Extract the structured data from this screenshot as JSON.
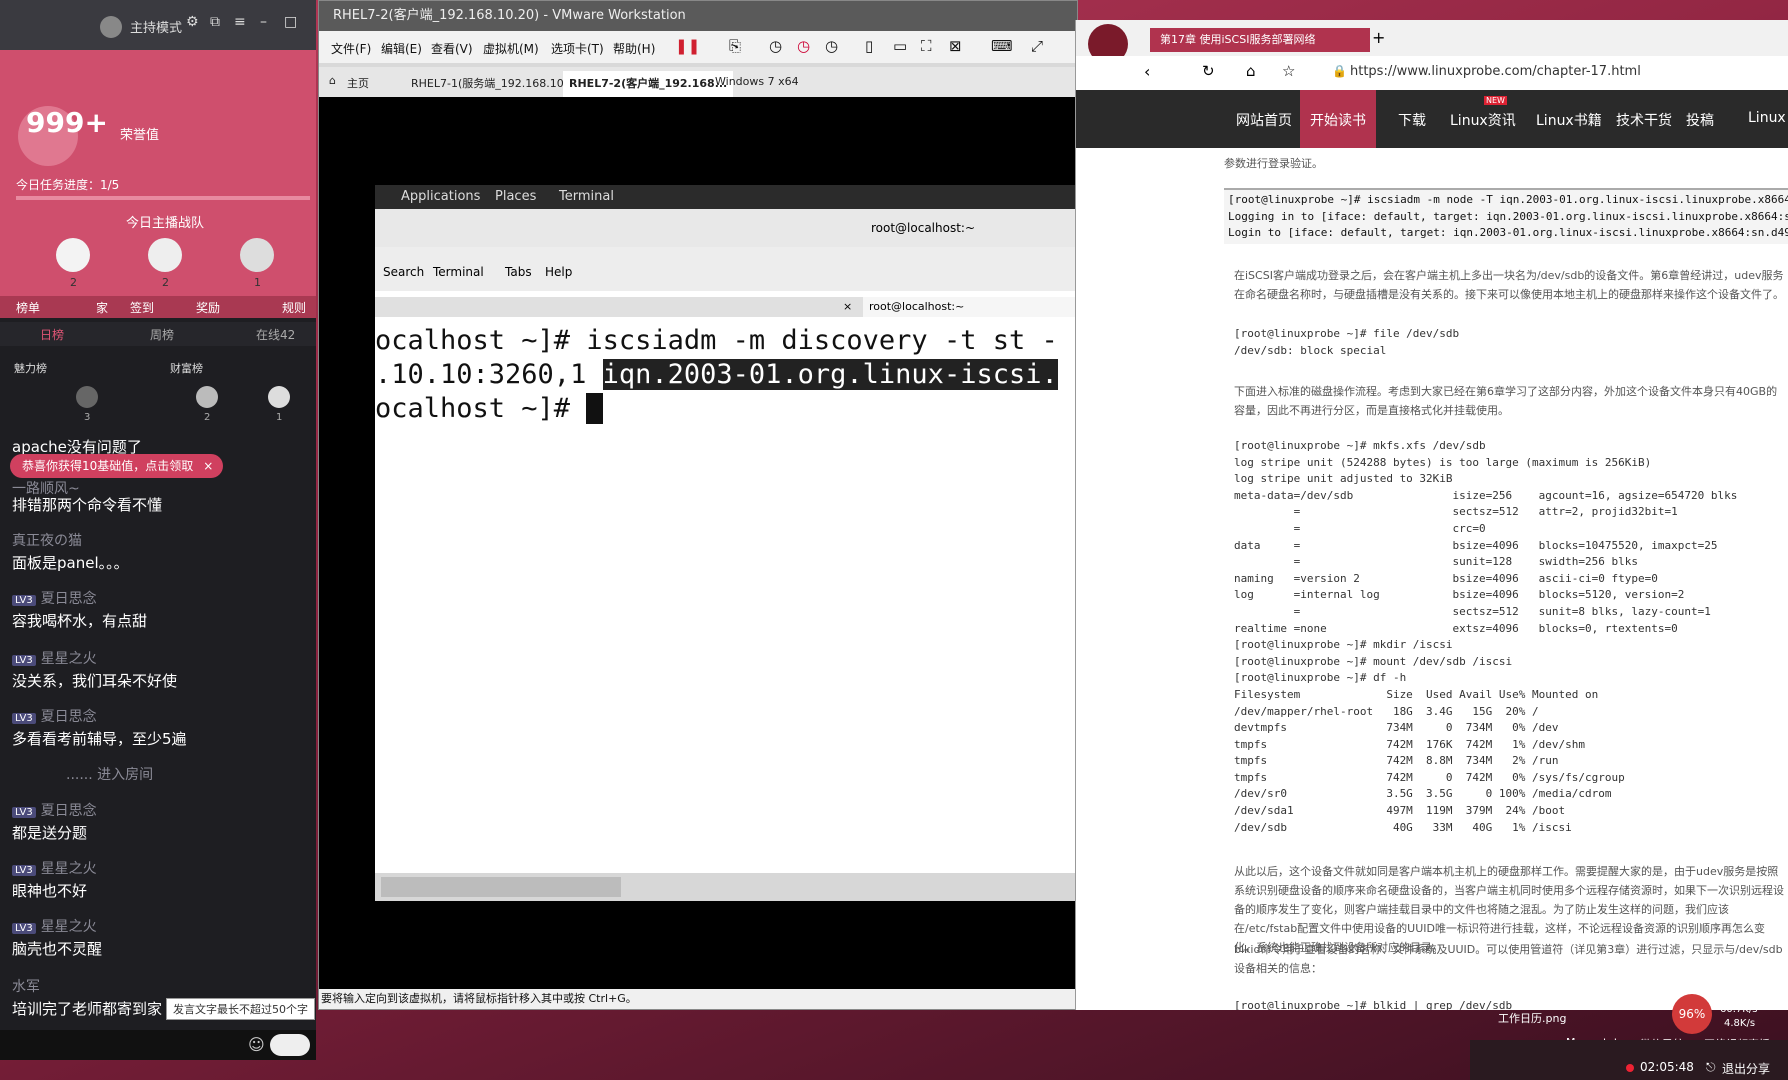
{
  "live_panel": {
    "mode_label": "主持模式",
    "score": "999+",
    "honor_label": "荣誉值",
    "task_progress": "今日任务进度：1/5",
    "anchor_team": "今日主播战队",
    "avatars_counts": [
      "2",
      "2",
      "1"
    ],
    "bottom_tabs": [
      "榜单",
      "家",
      "签到",
      "奖励",
      "规则"
    ],
    "list_tabs": [
      "日榜",
      "周榜",
      "在线42"
    ],
    "rank_headers": [
      "魅力榜",
      "财富榜"
    ],
    "rank_counts": [
      "3",
      "2",
      "1"
    ],
    "notification": "恭喜你获得10基础值，点击领取",
    "chat": [
      {
        "user": "",
        "text": "apache没有问题了"
      },
      {
        "user": "一路顺风~",
        "text": "排错那两个命令看不懂"
      },
      {
        "user": "真正夜の猫",
        "text": "面板是panel。。。"
      },
      {
        "user": "夏日思念",
        "lv": "LV3",
        "text": "容我喝杯水，有点甜"
      },
      {
        "user": "星星之火",
        "lv": "LV3",
        "text": "没关系，我们耳朵不好使"
      },
      {
        "user": "夏日思念",
        "lv": "LV3",
        "text": "多看看考前辅导，至少5遍"
      },
      {
        "user": "",
        "text": "...... 进入房间"
      },
      {
        "user": "夏日思念",
        "lv": "LV3",
        "text": "都是送分题"
      },
      {
        "user": "星星之火",
        "lv": "LV3",
        "text": "眼神也不好"
      },
      {
        "user": "星星之火",
        "lv": "LV3",
        "text": "脑壳也不灵醒"
      },
      {
        "user": "水军",
        "text": "培训完了老师都寄到家"
      }
    ],
    "input_hint": "发言文字最长不超过50个字"
  },
  "vmware": {
    "title": "RHEL7-2(客户端_192.168.10.20) - VMware Workstation",
    "menu": [
      "文件(F)",
      "编辑(E)",
      "查看(V)",
      "虚拟机(M)",
      "选项卡(T)",
      "帮助(H)"
    ],
    "tabs": [
      "主页",
      "RHEL7-1(服务端_192.168.10...",
      "RHEL7-2(客户端_192.168...",
      "Windows 7 x64"
    ],
    "status": "要将输入定向到该虚拟机，请将鼠标指针移入其中或按 Ctrl+G。",
    "gnome": {
      "applications": "Applications",
      "places": "Places",
      "terminal": "Terminal"
    },
    "term_title": "root@localhost:~",
    "term_menu": [
      "Search",
      "Terminal",
      "Tabs",
      "Help"
    ],
    "term_tab": "root@localhost:~",
    "lines": [
      "ocalhost ~]# iscsiadm -m discovery -t st -",
      ".10.10:3260,1 ",
      "iqn.2003-01.org.linux-iscsi.",
      "ocalhost ~]# "
    ]
  },
  "browser": {
    "tab_title": "第17章 使用iSCSI服务部署网络",
    "url": "https://www.linuxprobe.com/chapter-17.html",
    "nav": [
      "网站首页",
      "开始读书",
      "下载",
      "Linux资讯",
      "Linux书籍",
      "技术干货",
      "投稿",
      "Linux"
    ],
    "nav_badge": "NEW",
    "intro": "参数进行登录验证。",
    "code1": "[root@linuxprobe ~]# iscsiadm -m node -T iqn.2003-01.org.linux-iscsi.linuxprobe.x8664\nLogging in to [iface: default, target: iqn.2003-01.org.linux-iscsi.linuxprobe.x8664:sn\nLogin to [iface: default, target: iqn.2003-01.org.linux-iscsi.linuxprobe.x8664:sn.d497",
    "para1": "在iSCSI客户端成功登录之后，会在客户端主机上多出一块名为/dev/sdb的设备文件。第6章曾经讲过，udev服务在命名硬盘名称时，与硬盘插槽是没有关系的。接下来可以像使用本地主机上的硬盘那样来操作这个设备文件了。",
    "code2": "[root@linuxprobe ~]# file /dev/sdb\n/dev/sdb: block special",
    "para2": "下面进入标准的磁盘操作流程。考虑到大家已经在第6章学习了这部分内容，外加这个设备文件本身只有40GB的容量，因此不再进行分区，而是直接格式化并挂载使用。",
    "code3": "[root@linuxprobe ~]# mkfs.xfs /dev/sdb\nlog stripe unit (524288 bytes) is too large (maximum is 256KiB)\nlog stripe unit adjusted to 32KiB\nmeta-data=/dev/sdb               isize=256    agcount=16, agsize=654720 blks\n         =                       sectsz=512   attr=2, projid32bit=1\n         =                       crc=0\ndata     =                       bsize=4096   blocks=10475520, imaxpct=25\n         =                       sunit=128    swidth=256 blks\nnaming   =version 2              bsize=4096   ascii-ci=0 ftype=0\nlog      =internal log           bsize=4096   blocks=5120, version=2\n         =                       sectsz=512   sunit=8 blks, lazy-count=1\nrealtime =none                   extsz=4096   blocks=0, rtextents=0\n[root@linuxprobe ~]# mkdir /iscsi\n[root@linuxprobe ~]# mount /dev/sdb /iscsi\n[root@linuxprobe ~]# df -h\nFilesystem             Size  Used Avail Use% Mounted on\n/dev/mapper/rhel-root   18G  3.4G   15G  20% /\ndevtmpfs               734M     0  734M   0% /dev\ntmpfs                  742M  176K  742M   1% /dev/shm\ntmpfs                  742M  8.8M  734M   2% /run\ntmpfs                  742M     0  742M   0% /sys/fs/cgroup\n/dev/sr0               3.5G  3.5G     0 100% /media/cdrom\n/dev/sda1              497M  119M  379M  24% /boot\n/dev/sdb                40G   33M   40G   1% /iscsi",
    "para3": "从此以后，这个设备文件就如同是客户端本机主机上的硬盘那样工作。需要提醒大家的是，由于udev服务是按照系统识别硬盘设备的顺序来命名硬盘设备的，当客户端主机同时使用多个远程存储资源时，如果下一次识别远程设备的顺序发生了变化，则客户端挂载目录中的文件也将随之混乱。为了防止发生这样的问题，我们应该在/etc/fstab配置文件中使用设备的UUID唯一标识符进行挂载，这样，不论远程设备资源的识别顺序再怎么变化，系统也能正确找到设备所对应的目录。",
    "para4": "blkid命令用于查看设备的名称、文件系统及UUID。可以使用管道符（详见第3章）进行过滤，只显示与/dev/sdb设备相关的信息：",
    "code4": "[root@linuxprobe ~]# blkid | grep /dev/sdb"
  },
  "desktop": {
    "icons": [
      "工作日历.png",
      "Memo.txt",
      "微信导航",
      "网络视频直播"
    ],
    "net_percent": "96%",
    "net_up": "60.7K/s",
    "net_down": "4.8K/s",
    "timer": "02:05:48",
    "exit_share": "退出分享"
  }
}
